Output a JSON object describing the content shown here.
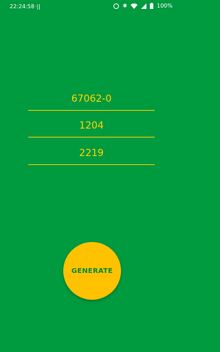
{
  "status_bar": {
    "time": "22:24:58",
    "left_indicator": "⋅||",
    "battery_percent": "100%",
    "icons": [
      "alarm-icon",
      "bluetooth-icon",
      "wifi-icon",
      "signal-icon",
      "battery-icon"
    ]
  },
  "fields": [
    {
      "value": "67062-0"
    },
    {
      "value": "1204"
    },
    {
      "value": "2219"
    }
  ],
  "generate_button": {
    "label": "GENERATE"
  },
  "colors": {
    "background": "#009a3f",
    "accent": "#ffd400",
    "button": "#ffc200",
    "button_text": "#0a8a35"
  }
}
